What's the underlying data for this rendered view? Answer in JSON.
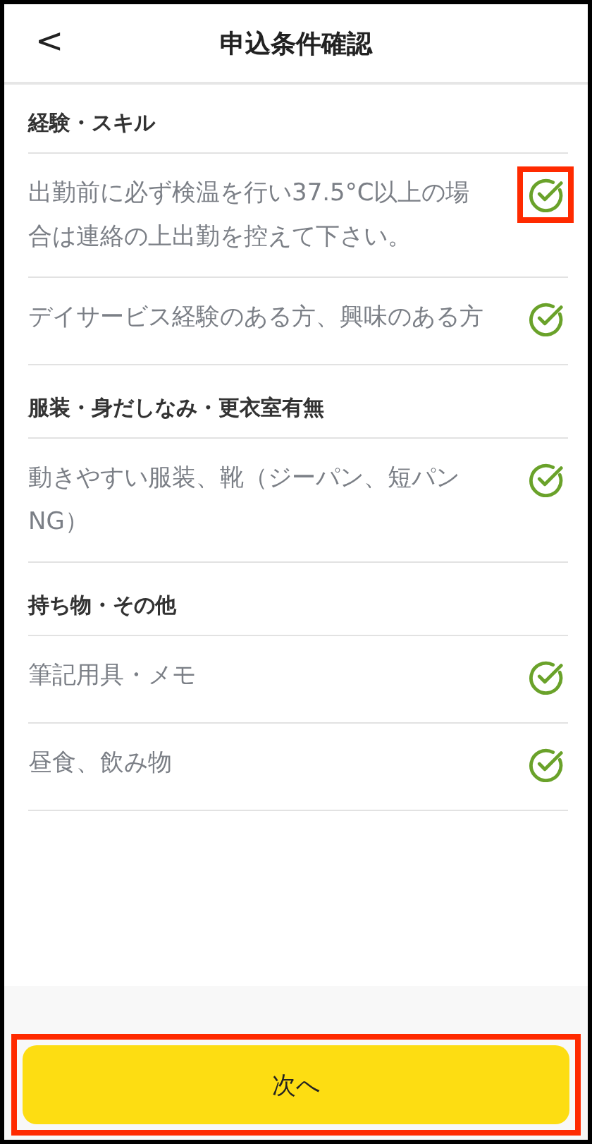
{
  "header": {
    "back": "<",
    "title": "申込条件確認"
  },
  "sections": [
    {
      "title": "経験・スキル",
      "items": [
        {
          "text": "出勤前に必ず検温を行い37.5°C以上の場合は連絡の上出勤を控えて下さい。",
          "checked": true,
          "highlighted": true
        },
        {
          "text": "デイサービス経験のある方、興味のある方",
          "checked": true,
          "highlighted": false
        }
      ]
    },
    {
      "title": "服装・身だしなみ・更衣室有無",
      "items": [
        {
          "text": "動きやすい服装、靴（ジーパン、短パンNG）",
          "checked": true,
          "highlighted": false
        }
      ]
    },
    {
      "title": "持ち物・その他",
      "items": [
        {
          "text": "筆記用具・メモ",
          "checked": true,
          "highlighted": false
        },
        {
          "text": "昼食、飲み物",
          "checked": true,
          "highlighted": false
        }
      ]
    }
  ],
  "next_button": {
    "label": "次へ",
    "highlighted": true
  }
}
